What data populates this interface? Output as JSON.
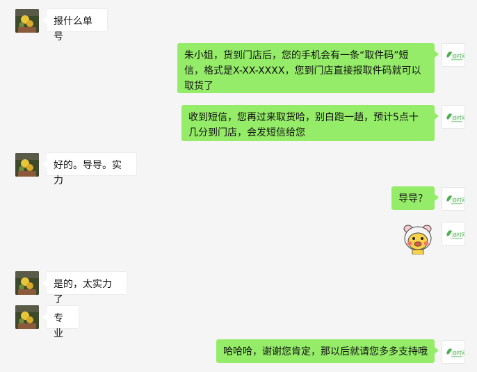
{
  "colors": {
    "background": "#f5f5f5",
    "bubble_self": "#95ec69",
    "bubble_other": "#ffffff",
    "brand_green": "#4caf50"
  },
  "messages": [
    {
      "side": "left",
      "text": "报什么单号"
    },
    {
      "side": "right",
      "text": "朱小姐，货到门店后，您的手机会有一条“取件码”短信，格式是X-XX-XXXX，您到门店直接报取件码就可以取货了"
    },
    {
      "side": "right",
      "text": "收到短信，您再过来取货哈，别白跑一趟，预计5点十几分到门店，会发短信给您"
    },
    {
      "side": "left",
      "text": "好的。导导。实力"
    },
    {
      "side": "right",
      "text": "导导？"
    },
    {
      "side": "right",
      "sticker": "pig-face-sticker"
    },
    {
      "side": "left",
      "text": "是的，太实力了"
    },
    {
      "side": "left",
      "text": "专业"
    },
    {
      "side": "right",
      "text": "哈哈哈，谢谢您肯定，那以后就请您多多支持哦"
    }
  ],
  "self_avatar": {
    "brand_text": "迪村网"
  }
}
